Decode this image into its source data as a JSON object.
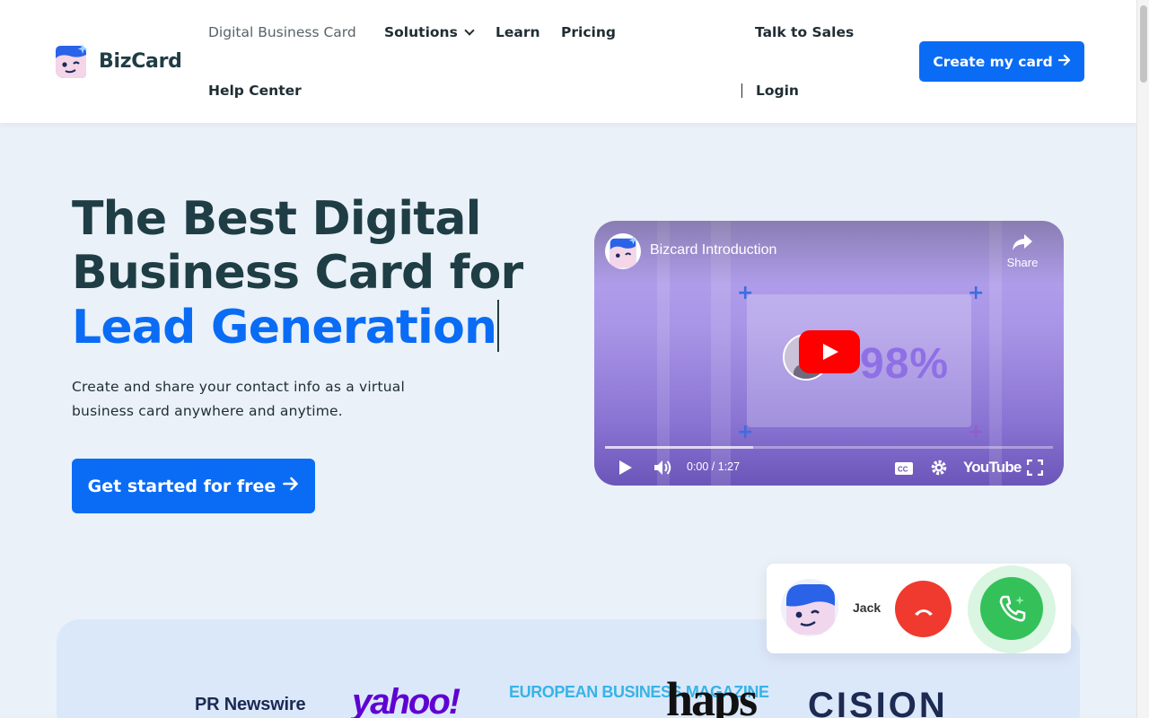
{
  "brand": {
    "name": "BizCard"
  },
  "nav": {
    "items": [
      {
        "label": "Digital Business Card"
      },
      {
        "label": "Solutions"
      },
      {
        "label": "Learn"
      },
      {
        "label": "Pricing"
      },
      {
        "label": "Help Center"
      }
    ],
    "talk_to_sales": "Talk to Sales",
    "login": "Login",
    "cta": "Create my card"
  },
  "hero": {
    "title_line1": "The Best Digital",
    "title_line2": "Business Card for",
    "title_highlight": "Lead Generation",
    "subtitle": "Create and share your contact info as a virtual business card anywhere and anytime.",
    "cta": "Get started for free"
  },
  "video": {
    "title": "Bizcard Introduction",
    "share_label": "Share",
    "overlay_stat": "98%",
    "time": "0:00 / 1:27",
    "progress": 0.33,
    "platform": "YouTube"
  },
  "call_widget": {
    "caller_name": "Jack"
  },
  "press": {
    "logos": [
      {
        "name": "PR Newswire",
        "text": "PR Newswire"
      },
      {
        "name": "Yahoo",
        "text": "yahoo!"
      },
      {
        "name": "European Business Magazine",
        "text": "EUROPEAN BUSINESS MAGAZINE"
      },
      {
        "name": "haps",
        "text": "haps"
      },
      {
        "name": "Cision",
        "text": "CISION"
      }
    ]
  },
  "colors": {
    "primary": "#0a6cf5",
    "heading": "#1f3d44",
    "page_bg": "#eaf1f8",
    "decline": "#f03a2f",
    "accept": "#34c15a"
  }
}
